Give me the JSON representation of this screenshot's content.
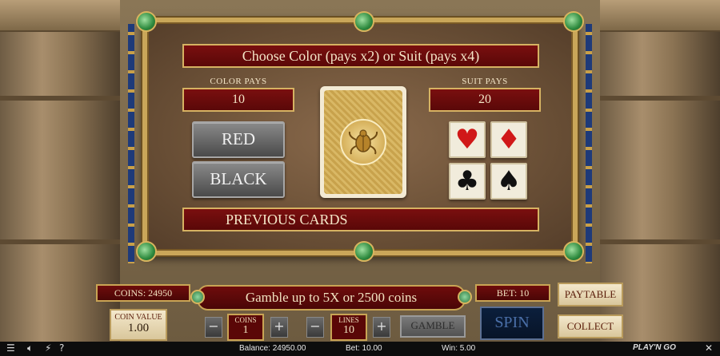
{
  "gamble_panel": {
    "title": "Choose Color (pays x2) or Suit (pays x4)",
    "color_pays_label": "COLOR PAYS",
    "color_pays_value": "10",
    "suit_pays_label": "SUIT PAYS",
    "suit_pays_value": "20",
    "red_label": "RED",
    "black_label": "BLACK",
    "previous_cards_label": "PREVIOUS CARDS",
    "suits": {
      "hearts": "♥",
      "diamonds": "♦",
      "clubs": "♣",
      "spades": "♠"
    },
    "card_back_icon": "scarab-icon"
  },
  "controls": {
    "coins_display": "COINS: 24950",
    "gamble_message": "Gamble up to 5X or 2500 coins",
    "bet_display": "BET: 10",
    "paytable_label": "PAYTABLE",
    "collect_label": "COLLECT",
    "coin_value_label": "COIN VALUE",
    "coin_value": "1.00",
    "coins_label": "COINS",
    "coins_value": "1",
    "lines_label": "LINES",
    "lines_value": "10",
    "gamble_label": "GAMBLE",
    "spin_label": "SPIN",
    "minus_glyph": "−",
    "plus_glyph": "+"
  },
  "status_bar": {
    "balance": "Balance: 24950.00",
    "bet": "Bet: 10.00",
    "win": "Win: 5.00",
    "logo": "PLAY'N GO",
    "icons": [
      "menu-icon",
      "sound-icon",
      "turbo-icon",
      "help-icon",
      "close-icon"
    ]
  },
  "colors": {
    "banner_red": "#7a0f0f",
    "gold_border": "#c9a659",
    "suit_red": "#d01818"
  }
}
